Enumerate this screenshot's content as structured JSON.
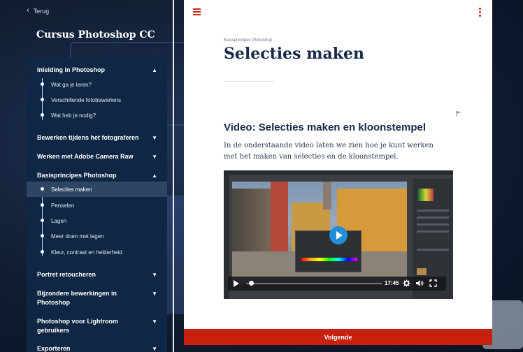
{
  "sidebar": {
    "back_label": "Terug",
    "course_title": "Cursus Photoshop CC",
    "sections": [
      {
        "label": "Inleiding in Photoshop",
        "expanded": true,
        "items": [
          "Wat ga je leren?",
          "Verschillende fotobewerkers",
          "Wat heb je nodig?"
        ]
      },
      {
        "label": "Bewerken tijdens het fotograferen",
        "expanded": false
      },
      {
        "label": "Werken met Adobe Camera Raw",
        "expanded": false
      },
      {
        "label": "Basisprincipes Photoshop",
        "expanded": true,
        "items": [
          "Selecties maken",
          "Penselen",
          "Lagen",
          "Meer doen met lagen",
          "Kleur, contrast en helderheid"
        ],
        "active_item": "Selecties maken"
      },
      {
        "label": "Portret retoucheren",
        "expanded": false
      },
      {
        "label": "Bijzondere bewerkingen in Photoshop",
        "expanded": false
      },
      {
        "label": "Photoshop voor Lightroom gebruikers",
        "expanded": false
      },
      {
        "label": "Exporteren",
        "expanded": false
      }
    ]
  },
  "main": {
    "breadcrumb": "Basisprincipes Photoshop",
    "title": "Selecties maken",
    "section_title": "Video: Selecties maken en kloonstempel",
    "intro": "In de onderstaande video laten we zien hoe je kunt werken met het maken van selecties en de kloonstempel.",
    "video": {
      "duration": "17:45",
      "progress": 0.02
    },
    "next_label": "Volgende"
  },
  "colors": {
    "accent": "#c8200f",
    "nav_bg": "#0f2744",
    "play": "#1e8fd8"
  },
  "icons": [
    "chevron-left-icon",
    "menu-icon",
    "more-vertical-icon",
    "flag-icon",
    "play-icon",
    "gear-icon",
    "volume-icon",
    "fullscreen-icon",
    "chevron-up-icon",
    "chevron-down-icon"
  ]
}
